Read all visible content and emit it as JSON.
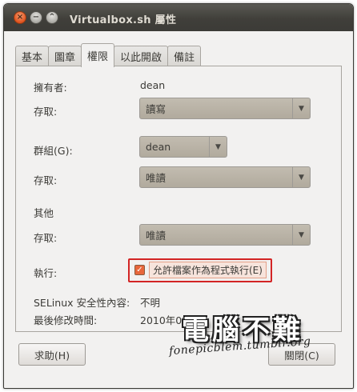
{
  "window": {
    "title": "Virtualbox.sh 屬性",
    "buttons": {
      "close": "×",
      "minimize": "−",
      "maximize": "⌃"
    }
  },
  "tabs": [
    {
      "label": "基本",
      "active": false
    },
    {
      "label": "圖章",
      "active": false
    },
    {
      "label": "權限",
      "active": true
    },
    {
      "label": "以此開啟",
      "active": false
    },
    {
      "label": "備註",
      "active": false
    }
  ],
  "permissions": {
    "owner_label": "擁有者:",
    "owner_value": "dean",
    "owner_access_label": "存取:",
    "owner_access_value": "讀寫",
    "group_label": "群組(G):",
    "group_value": "dean",
    "group_access_label": "存取:",
    "group_access_value": "唯讀",
    "others_label": "其他",
    "others_access_label": "存取:",
    "others_access_value": "唯讀",
    "execute_label": "執行:",
    "execute_checkbox_label": "允許檔案作為程式執行(E)",
    "execute_checked": true,
    "selinux_label": "SELinux 安全性內容:",
    "selinux_value": "不明",
    "modified_label": "最後修改時間:",
    "modified_value": "2010年05月"
  },
  "footer": {
    "help_label": "求助(H)",
    "close_label": "關閉(C)"
  },
  "watermark": {
    "logo": "電腦不難",
    "url": "fonepicblem.tumblr.org"
  },
  "colors": {
    "accent": "#e8673c",
    "highlight_border": "#d32424",
    "titlebar": "#3c3b37"
  }
}
